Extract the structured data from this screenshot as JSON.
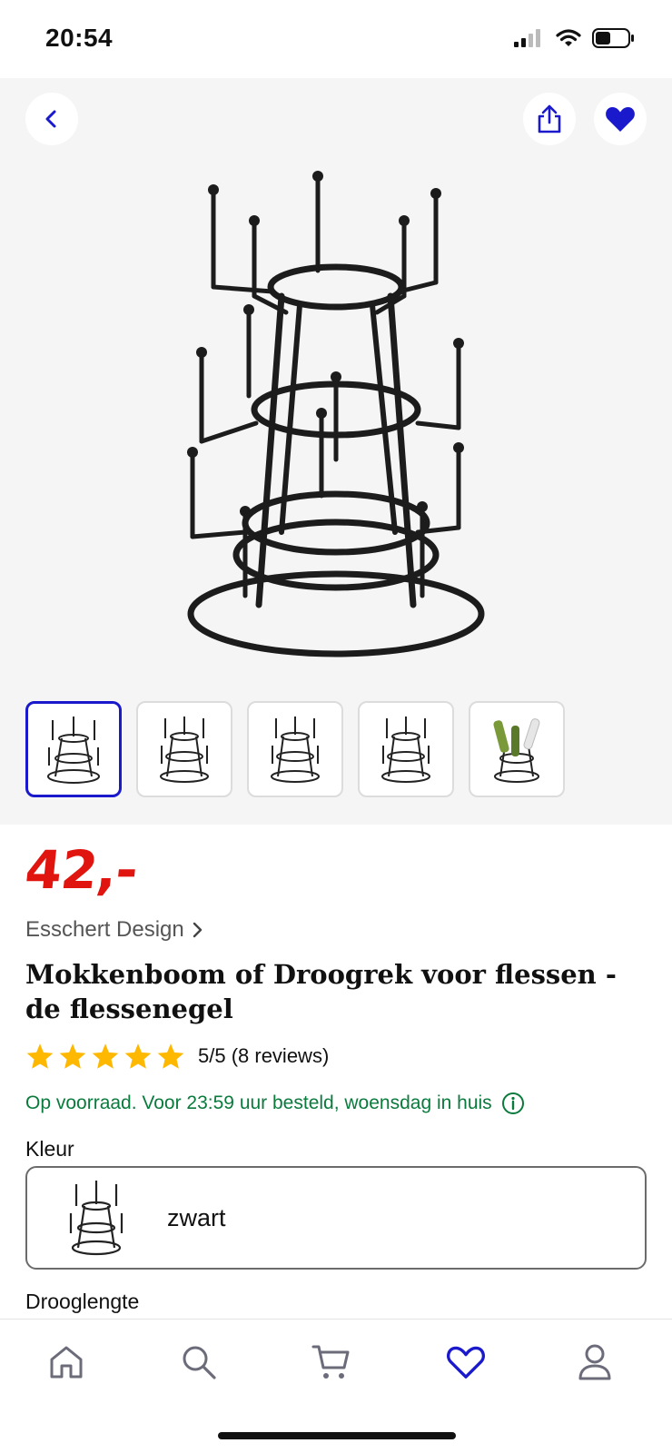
{
  "status_bar": {
    "time": "20:54",
    "icons": [
      "signal-icon",
      "wifi-icon",
      "battery-icon"
    ]
  },
  "gallery": {
    "buttons": [
      "back-icon",
      "share-icon",
      "heart-icon"
    ],
    "thumbnail_count": 5,
    "active_thumbnail": 1
  },
  "product": {
    "price": "42,-",
    "brand": "Esschert Design",
    "title": "Mokkenboom of Droogrek voor flessen - de flessenegel",
    "rating": {
      "stars": 5,
      "text": "5/5 (8 reviews)"
    },
    "stock": "Op voorraad. Voor 23:59 uur besteld, woensdag in huis"
  },
  "options": {
    "color_label": "Kleur",
    "color_value": "zwart",
    "length_label": "Drooglengte"
  },
  "bottom_nav": [
    "home-icon",
    "search-icon",
    "cart-icon",
    "heart-icon",
    "account-icon"
  ],
  "colors": {
    "accent_blue": "#1a1acc",
    "price_red": "#e0150f",
    "stock_green": "#0a7a3d"
  }
}
